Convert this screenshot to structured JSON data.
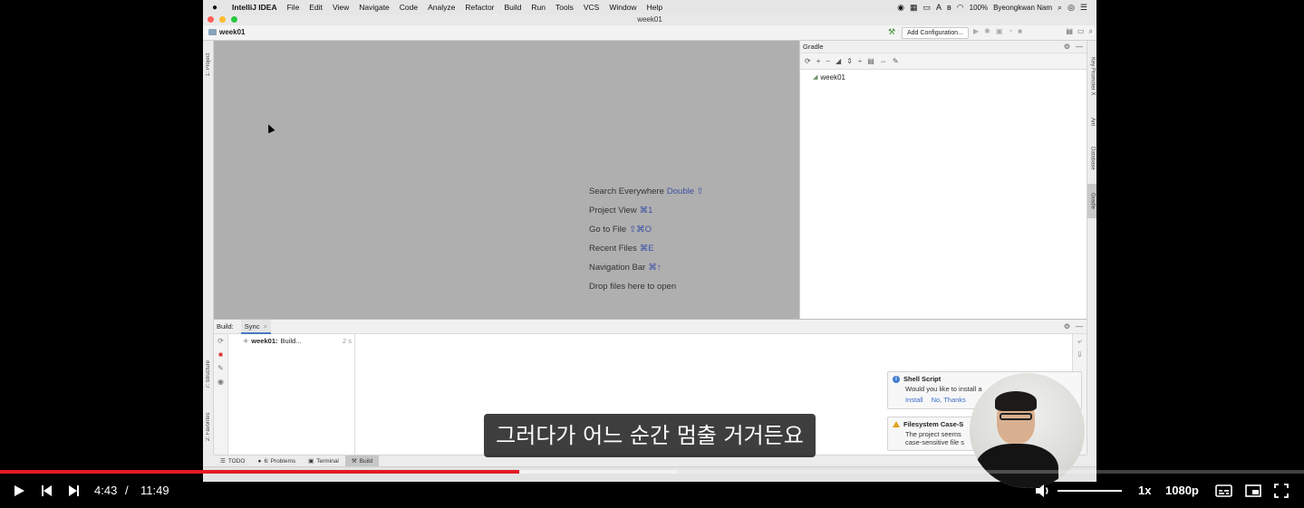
{
  "screen": {
    "menubar": {
      "app_name": "IntelliJ IDEA",
      "items": [
        "File",
        "Edit",
        "View",
        "Navigate",
        "Code",
        "Analyze",
        "Refactor",
        "Build",
        "Run",
        "Tools",
        "VCS",
        "Window",
        "Help"
      ],
      "battery": "100%",
      "user": "Byeongkwan Nam"
    },
    "window_title": "week01",
    "navbar": {
      "project": "week01",
      "add_configuration": "Add Configuration..."
    },
    "left_tabs": {
      "project": "1: Project",
      "structure": "7: Structure",
      "favorites": "2: Favorites"
    },
    "right_tabs": {
      "key_promoter": "Key Promoter X",
      "ant": "Ant",
      "database": "Database",
      "gradle": "Gradle"
    },
    "editor_hints": [
      {
        "label": "Search Everywhere",
        "key": "Double ⇧"
      },
      {
        "label": "Project View",
        "key": "⌘1"
      },
      {
        "label": "Go to File",
        "key": "⇧⌘O"
      },
      {
        "label": "Recent Files",
        "key": "⌘E"
      },
      {
        "label": "Navigation Bar",
        "key": "⌘↑"
      },
      {
        "label": "Drop files here to open",
        "key": ""
      }
    ],
    "gradle_panel": {
      "title": "Gradle",
      "tree_root": "week01"
    },
    "build_panel": {
      "label": "Build:",
      "tab": "Sync",
      "tree_item_name": "week01:",
      "tree_item_status": "Build...",
      "tree_item_count": "2 s"
    },
    "notifications": [
      {
        "title": "Shell Script",
        "body": "Would you like to install a",
        "actions": [
          "Install",
          "No, Thanks"
        ]
      },
      {
        "title": "Filesystem Case-S",
        "body": "The project seems",
        "body2": "case-sensitive file s"
      }
    ],
    "bottom_tabs": [
      "TODO",
      "6: Problems",
      "Terminal",
      "Build"
    ]
  },
  "subtitle": "그러다가 어느 순간 멈출 거거든요",
  "player": {
    "current_time": "4:43",
    "separator": "/",
    "duration": "11:49",
    "played_fraction": 0.398,
    "buffered_fraction": 0.52,
    "speed": "1x",
    "quality": "1080p",
    "accent_color": "#e21b23"
  }
}
